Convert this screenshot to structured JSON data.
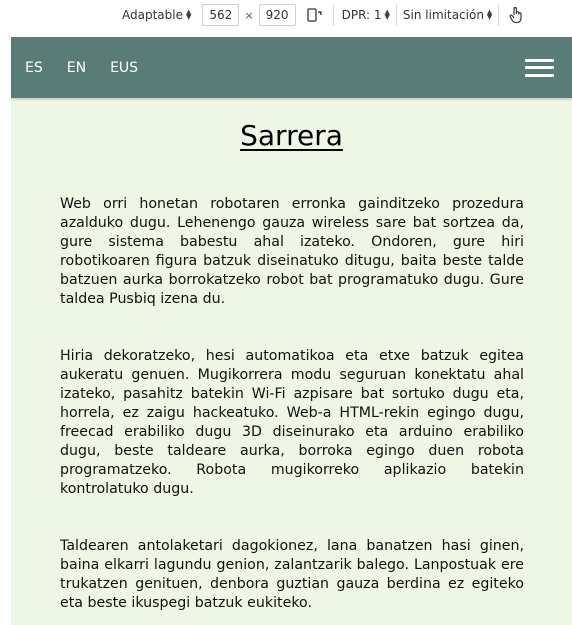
{
  "devtools": {
    "device_label": "Adaptable",
    "width_value": "562",
    "height_value": "920",
    "times_symbol": "×",
    "dpr_label": "DPR: 1",
    "throttle_label": "Sin limitación",
    "rotate_icon": "rotate-device-icon",
    "touch_icon": "touch-hand-icon"
  },
  "header": {
    "languages": [
      "ES",
      "EN",
      "EUS"
    ],
    "menu_icon": "hamburger-menu-icon",
    "background_color": "#5a7c76"
  },
  "page": {
    "title": "Sarrera",
    "background_color": "#eef7e6",
    "paragraphs": [
      "Web orri honetan robotaren erronka gainditzeko prozedura azalduko dugu. Lehenengo gauza wireless sare bat sortzea da, gure sistema babestu ahal izateko. Ondoren, gure hiri robotikoaren figura batzuk diseinatuko ditugu, baita beste talde batzuen aurka borrokatzeko robot bat programatuko dugu. Gure taldea Pusbiq izena du.",
      "Hiria dekoratzeko, hesi automatikoa eta etxe batzuk egitea aukeratu genuen. Mugikorrera modu seguruan konektatu ahal izateko, pasahitz batekin Wi-Fi azpisare bat sortuko dugu eta, horrela, ez zaigu hackeatuko. Web-a HTML-rekin egingo dugu, freecad erabiliko dugu 3D diseinurako eta arduino erabiliko dugu, beste taldeare aurka, borroka egingo duen robota programatzeko. Robota mugikorreko aplikazio batekin kontrolatuko dugu.",
      "Taldearen antolaketari dagokionez, lana banatzen hasi ginen, baina elkarri lagundu genion, zalantzarik balego. Lanpostuak ere trukatzen genituen, denbora guztian gauza berdina ez egiteko eta beste ikuspegi batzuk eukiteko."
    ]
  }
}
